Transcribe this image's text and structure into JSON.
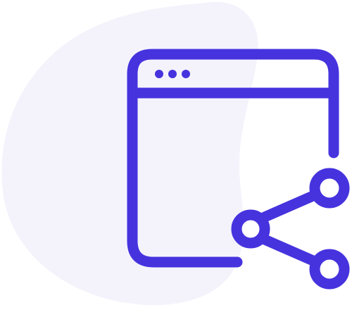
{
  "illustration": {
    "icon_name": "browser-window-share-icon",
    "colors": {
      "stroke": "#4633DE",
      "blob": "#F4F3FC",
      "background": "#FFFFFF"
    }
  }
}
